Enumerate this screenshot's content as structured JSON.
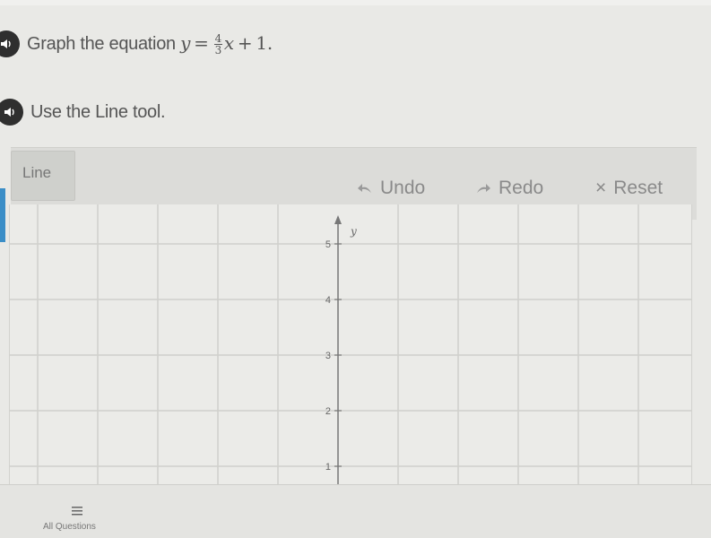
{
  "question": {
    "prompt_text": "Graph the equation",
    "equation": {
      "lhs": "y",
      "eq": "=",
      "numerator": "4",
      "denominator": "3",
      "var": "x",
      "plus": "+",
      "constant": "1",
      "end": "."
    },
    "instruction": "Use the Line tool."
  },
  "toolbar": {
    "line_label": "Line",
    "undo_label": "Undo",
    "redo_label": "Redo",
    "reset_label": "Reset",
    "reset_glyph": "×"
  },
  "graph": {
    "y_axis_label": "y",
    "y_ticks": [
      "1",
      "2",
      "3",
      "4",
      "5"
    ]
  },
  "footer": {
    "all_questions_label": "All Questions"
  },
  "colors": {
    "accent": "#3b8ec7",
    "axis": "#777777",
    "grid": "#d0d0cc"
  }
}
